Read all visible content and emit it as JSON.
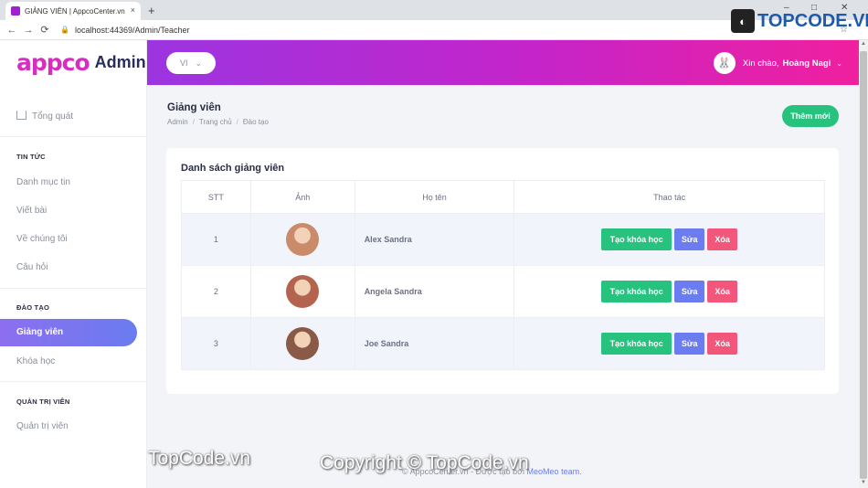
{
  "browser": {
    "tab_title": "GIẢNG VIÊN | AppcoCenter.vn",
    "url": "localhost:44369/Admin/Teacher",
    "new_tab": "+",
    "close": "×",
    "back": "←",
    "forward": "→",
    "reload": "⟳",
    "lock": "🔒",
    "star": "☆",
    "minimize": "–",
    "maximize": "□",
    "close_window": "✕"
  },
  "sidebar": {
    "brand": "appco",
    "brand_suffix": "Admin",
    "overview": "Tổng quát",
    "section_news": "TIN TỨC",
    "news_items": [
      "Danh mục tin",
      "Viết bài",
      "Về chúng tôi",
      "Câu hỏi"
    ],
    "section_training": "ĐÀO TẠO",
    "training_active": "Giảng viên",
    "training_items": [
      "Khóa học"
    ],
    "section_admin": "QUẢN TRỊ VIÊN",
    "admin_items": [
      "Quản trị viên"
    ]
  },
  "header": {
    "lang": "VI",
    "greeting": "Xin chào,",
    "user_name": "Hoàng Nagi",
    "avatar_icon": "🐰"
  },
  "page": {
    "title": "Giảng viên",
    "breadcrumb": [
      "Admin",
      "Trang chủ",
      "Đào tạo"
    ],
    "add_button": "Thêm mới"
  },
  "table": {
    "title": "Danh sách giảng viên",
    "columns": [
      "STT",
      "Ảnh",
      "Họ tên",
      "Thao tác"
    ],
    "rows": [
      {
        "index": "1",
        "name": "Alex Sandra",
        "photo_color": "#c98b6a"
      },
      {
        "index": "2",
        "name": "Angela Sandra",
        "photo_color": "#b4634e"
      },
      {
        "index": "3",
        "name": "Joe Sandra",
        "photo_color": "#8a5a48"
      }
    ],
    "actions": {
      "create": "Tạo khóa học",
      "edit": "Sửa",
      "delete": "Xóa"
    }
  },
  "footer": {
    "text": "© AppcoCenter.vn - Được tạo bởi",
    "team": "MeoMeo team."
  },
  "watermarks": {
    "left": "TopCode.vn",
    "center": "Copyright © TopCode.vn",
    "logo": "TOPCODE.VN"
  },
  "colors": {
    "accent_green": "#27c37e",
    "accent_blue": "#6a7cf0",
    "accent_red": "#f2577b",
    "header_start": "#9b35e0",
    "header_end": "#f0209e"
  }
}
